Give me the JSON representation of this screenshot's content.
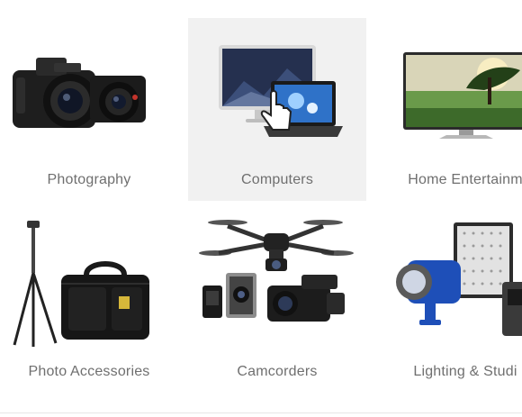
{
  "categories": [
    {
      "label": "Photography",
      "icon": "camera-icon"
    },
    {
      "label": "Computers",
      "icon": "computer-icon",
      "hovered": true
    },
    {
      "label": "Home Entertainm",
      "icon": "tv-icon"
    },
    {
      "label": "Photo Accessories",
      "icon": "tripod-bag-icon"
    },
    {
      "label": "Camcorders",
      "icon": "drone-camcorder-icon"
    },
    {
      "label": "Lighting & Studi",
      "icon": "studio-light-icon"
    }
  ],
  "colors": {
    "label": "#6f6f6f",
    "hover_bg": "#f1f1f1"
  }
}
